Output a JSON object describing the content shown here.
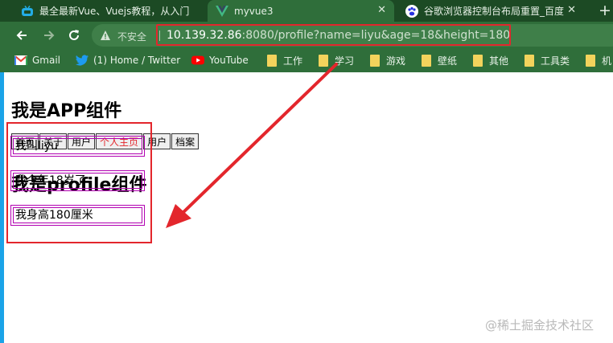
{
  "tabs": [
    {
      "title": "最全最新Vue、Vuejs教程，从入门",
      "icon": "bilibili-tv-icon"
    },
    {
      "title": "myvue3",
      "icon": "vue-logo-icon"
    },
    {
      "title": "谷歌浏览器控制台布局重置_百度",
      "icon": "baidu-paw-icon"
    }
  ],
  "toolbar": {
    "security_label": "不安全",
    "url_host": "10.139.32.86",
    "url_rest": ":8080/profile?name=liyu&age=18&height=180"
  },
  "bookmarks": [
    {
      "label": "Gmail",
      "icon": "gmail-icon"
    },
    {
      "label": "(1) Home / Twitter",
      "icon": "twitter-icon"
    },
    {
      "label": "YouTube",
      "icon": "youtube-icon"
    },
    {
      "label": "工作",
      "icon": "folder-icon"
    },
    {
      "label": "学习",
      "icon": "folder-icon"
    },
    {
      "label": "游戏",
      "icon": "folder-icon"
    },
    {
      "label": "壁纸",
      "icon": "folder-icon"
    },
    {
      "label": "其他",
      "icon": "folder-icon"
    },
    {
      "label": "工具类",
      "icon": "folder-icon"
    },
    {
      "label": "机",
      "icon": "folder-icon"
    }
  ],
  "page": {
    "app_title": "我是APP组件",
    "nav_buttons": [
      "首页",
      "关于",
      "用户",
      "个人主页",
      "用户",
      "档案"
    ],
    "active_button": "个人主页",
    "profile_title": "我是profile组件",
    "profile_lines": [
      "我叫liyu",
      "我今年18岁了",
      "我身高180厘米"
    ]
  },
  "colors": {
    "highlight_red": "#e3262c",
    "box_magenta": "#b100b1",
    "chrome_green": "#2f6e3a"
  },
  "watermark": "@稀土掘金技术社区"
}
